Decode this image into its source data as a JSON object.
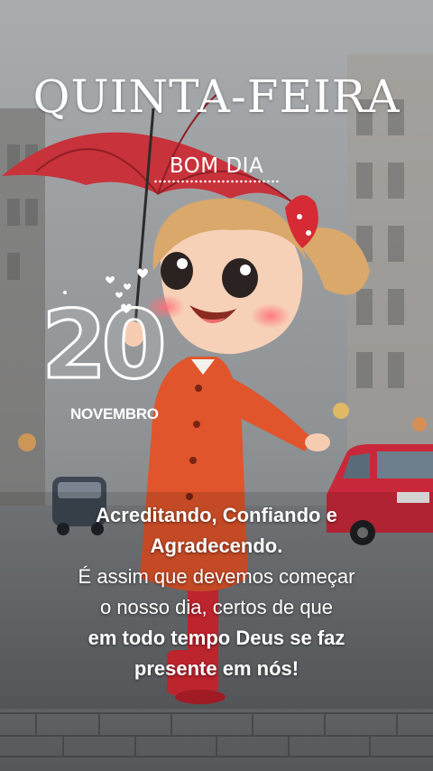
{
  "card": {
    "weekday": "QUINTA-FEIRA",
    "greeting": "BOM DIA",
    "day": "20",
    "month": "NOVEMBRO",
    "message": {
      "line1": "Acreditando, Confiando e",
      "line2": "Agradecendo.",
      "line3": "É assim que devemos começar",
      "line4": "o nosso dia, certos de que",
      "line5": "em todo tempo Deus se faz",
      "line6": "presente em nós!"
    }
  },
  "colors": {
    "umbrella": "#c8323a",
    "coat": "#e0552c",
    "car": "#c9283a",
    "text": "#ffffff"
  }
}
